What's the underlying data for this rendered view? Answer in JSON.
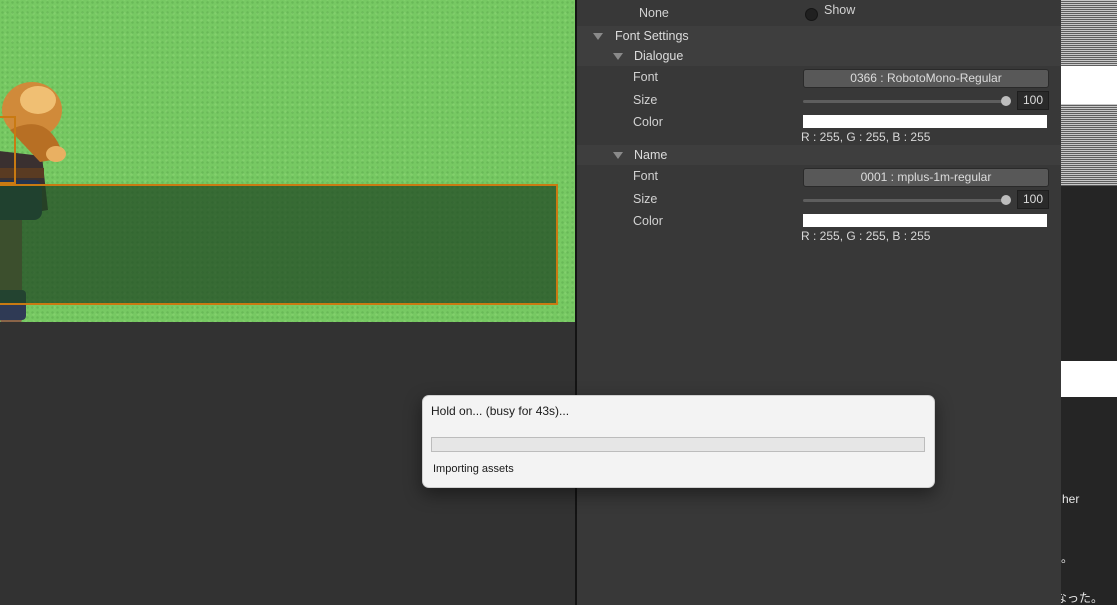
{
  "inspector": {
    "none_label": "None",
    "show_label": "Show",
    "font_settings_label": "Font Settings",
    "dialogue": {
      "section_label": "Dialogue",
      "font_label": "Font",
      "font_value": "0366 : RobotoMono-Regular",
      "size_label": "Size",
      "size_value": "100",
      "color_label": "Color",
      "color_hex": "#ffffff",
      "color_rgb": "R : 255, G : 255, B : 255"
    },
    "name": {
      "section_label": "Name",
      "font_label": "Font",
      "font_value": "0001 : mplus-1m-regular",
      "size_label": "Size",
      "size_value": "100",
      "color_label": "Color",
      "color_hex": "#ffffff",
      "color_rgb": "R : 255, G : 255, B : 255"
    }
  },
  "busy_dialog": {
    "title": "Hold on... (busy for 43s)...",
    "status": "Importing assets",
    "progress": 0
  },
  "side_window": {
    "text_1": "her",
    "text_2": "。",
    "text_3": "なった。"
  },
  "colors": {
    "selection_outline": "#c97a12",
    "grass": "#77c963",
    "inspector_bg": "#383838"
  }
}
